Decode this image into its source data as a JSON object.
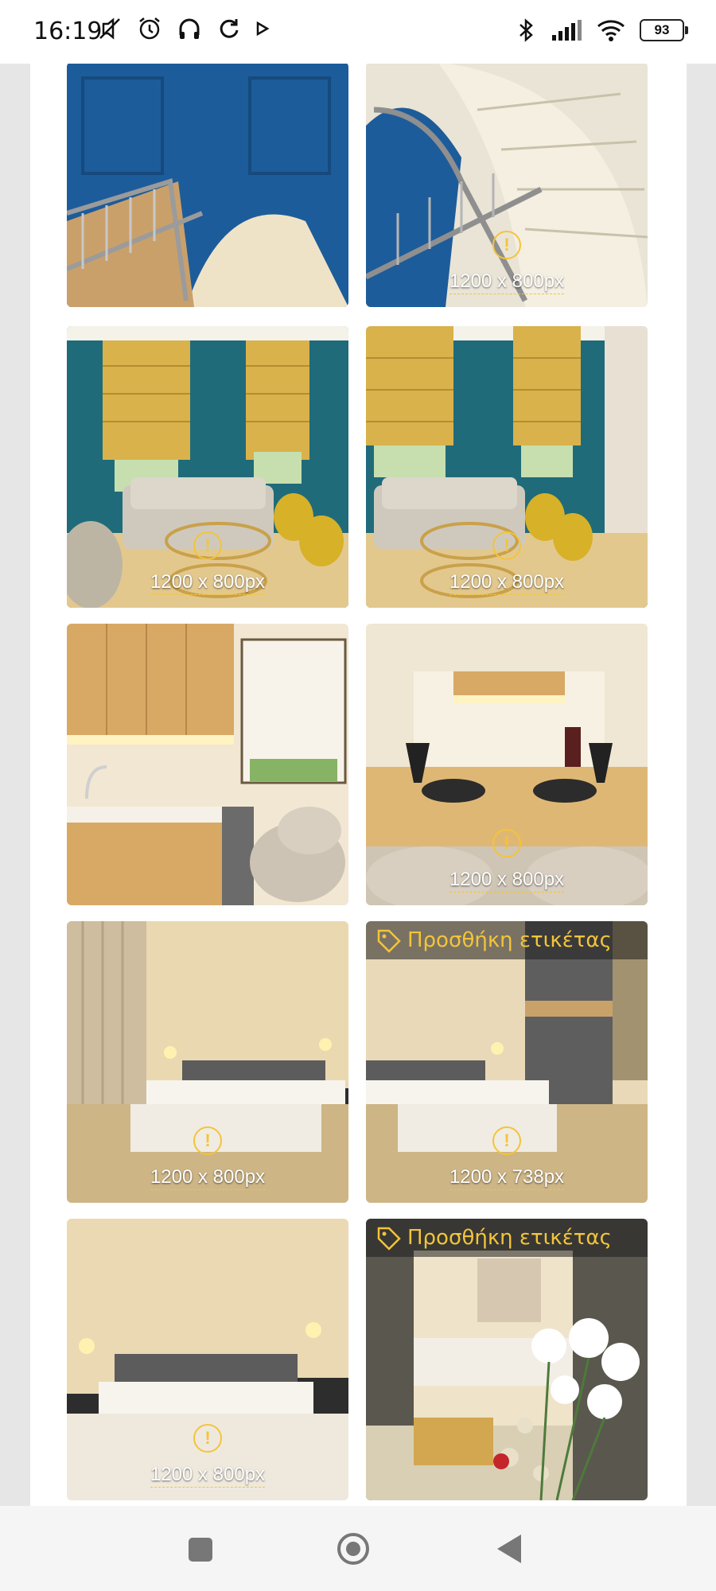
{
  "status_bar": {
    "time": "16:19",
    "battery": "93",
    "icons_left": [
      "mute-icon",
      "alarm-icon",
      "headphones-icon",
      "sync-icon",
      "play-icon"
    ],
    "icons_right": [
      "bluetooth-icon",
      "signal-icon",
      "wifi-icon",
      "battery-icon"
    ]
  },
  "gallery": {
    "items": [
      {
        "size_label": "",
        "has_tag": false,
        "scene": "staircase-blue"
      },
      {
        "size_label": "1200 x 800px",
        "has_tag": false,
        "scene": "staircase-white"
      },
      {
        "size_label": "1200 x 800px",
        "has_tag": false,
        "scene": "living-room"
      },
      {
        "size_label": "1200 x 800px",
        "has_tag": false,
        "scene": "living-room-2"
      },
      {
        "size_label": "",
        "has_tag": false,
        "scene": "kitchen"
      },
      {
        "size_label": "1200 x 800px",
        "has_tag": false,
        "scene": "dining"
      },
      {
        "size_label": "1200 x 800px",
        "has_tag": false,
        "scene": "bedroom"
      },
      {
        "size_label": "1200 x 738px",
        "has_tag": true,
        "scene": "bedroom-wardrobe"
      },
      {
        "size_label": "1200 x 800px",
        "has_tag": false,
        "scene": "bedroom-2"
      },
      {
        "size_label": "",
        "has_tag": true,
        "scene": "flowers"
      }
    ],
    "tag_label": "Προσθήκη ετικέτας"
  },
  "colors": {
    "accent": "#f3c43a",
    "blue_wall": "#1d5c9a",
    "teal_wall": "#1f6b7a",
    "wood": "#d8a964",
    "beige": "#e8dcc0"
  },
  "nav": {
    "buttons": [
      "recents-button",
      "home-button",
      "back-button"
    ]
  }
}
